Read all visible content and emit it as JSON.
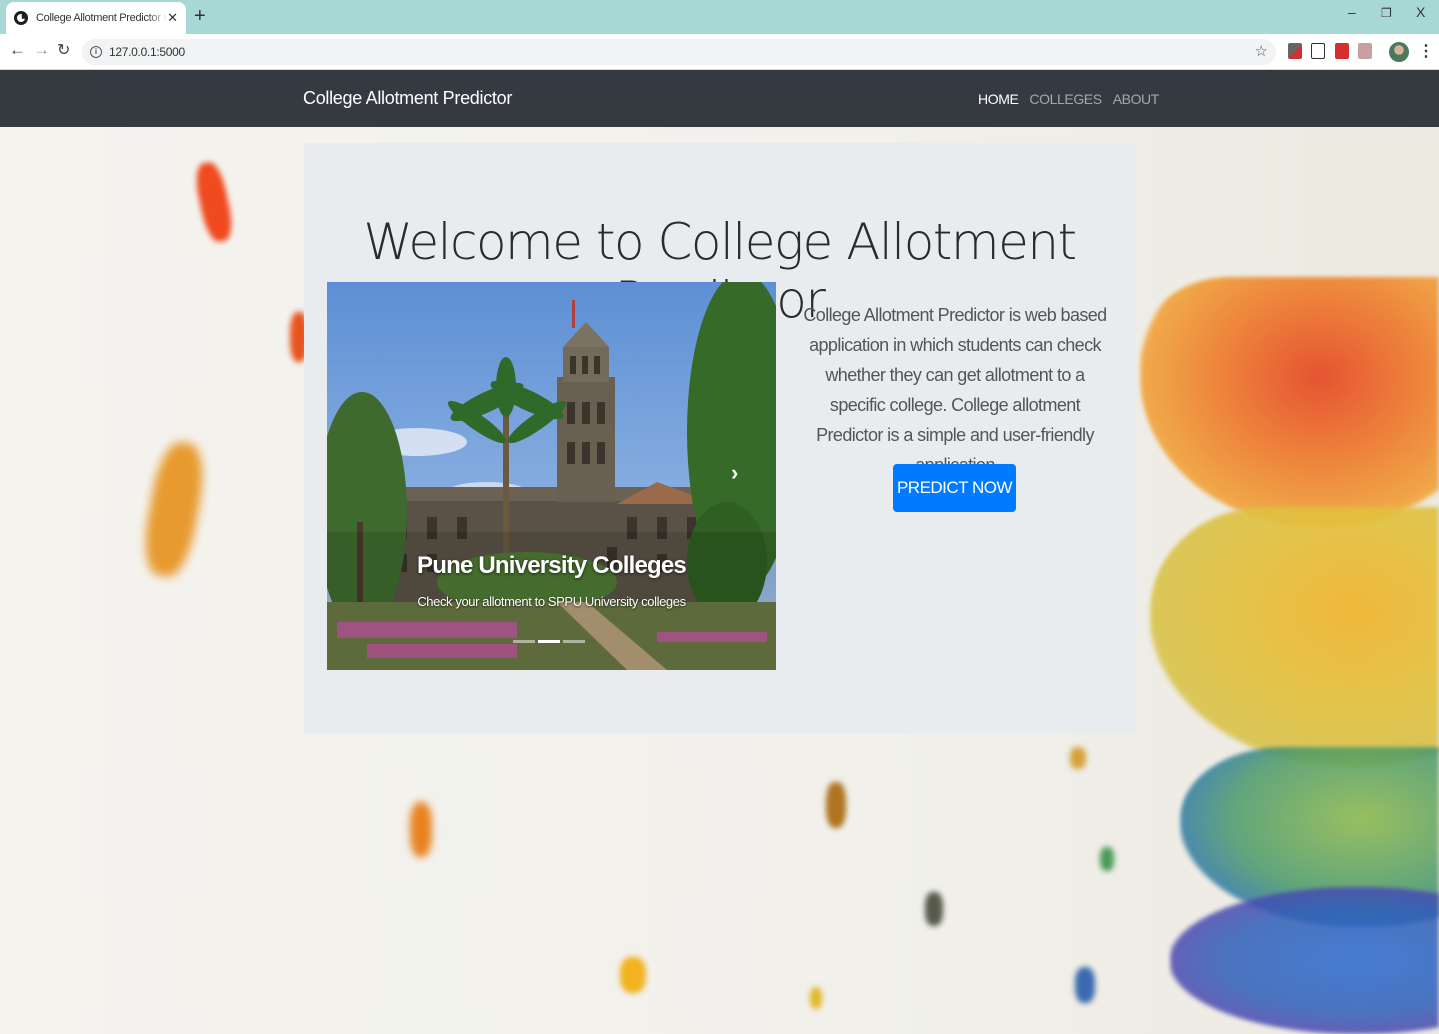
{
  "browser": {
    "tab_title": "College Allotment Predictor using Machine Learning",
    "new_tab_icon": "plus-icon",
    "url": "127.0.0.1:5000",
    "window_controls": {
      "minimize": "–",
      "restore": "❐",
      "close": "X"
    }
  },
  "navbar": {
    "brand": "College Allotment Predictor",
    "links": [
      {
        "label": "HOME",
        "active": true
      },
      {
        "label": "COLLEGES",
        "active": false
      },
      {
        "label": "ABOUT",
        "active": false
      }
    ]
  },
  "hero": {
    "title": "Welcome to College Allotment Predictor",
    "carousel": {
      "caption_title": "Pune University Colleges",
      "caption_text": "Check your allotment to SPPU University colleges",
      "slide_count": 3,
      "active_index": 1
    },
    "description": "College Allotment Predictor is web based application in which students can check whether they can get allotment to a specific college. College allotment Predictor is a simple and user-friendly application",
    "cta_label": "PREDICT NOW"
  },
  "colors": {
    "navbar_bg": "#343a40",
    "jumbotron_bg": "#e9ecef",
    "primary": "#007bff",
    "tabstrip": "#a8d8d6"
  }
}
